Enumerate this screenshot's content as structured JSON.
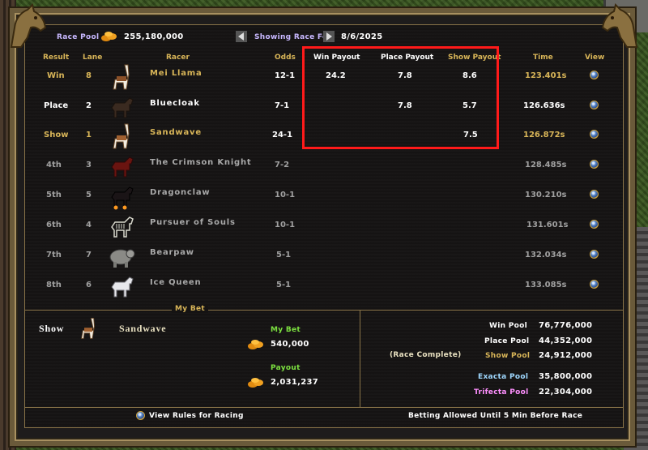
{
  "header": {
    "race_pool_label": "Race Pool",
    "race_pool_value": "255,180,000",
    "showing_label": "Showing Race For",
    "race_date": "8/6/2025"
  },
  "columns": {
    "result": "Result",
    "lane": "Lane",
    "racer": "Racer",
    "odds": "Odds",
    "win_payout": "Win Payout",
    "place_payout": "Place Payout",
    "show_payout": "Show Payout",
    "time": "Time",
    "view": "View"
  },
  "rows": [
    {
      "result": "Win",
      "lane": "8",
      "racer": "Mei Llama",
      "odds": "12-1",
      "win": "24.2",
      "place": "7.8",
      "show": "8.6",
      "time": "123.401s",
      "icon": "llama-icon"
    },
    {
      "result": "Place",
      "lane": "2",
      "racer": "Bluecloak",
      "odds": "7-1",
      "win": "",
      "place": "7.8",
      "show": "5.7",
      "time": "126.636s",
      "icon": "dark-horse-icon"
    },
    {
      "result": "Show",
      "lane": "1",
      "racer": "Sandwave",
      "odds": "24-1",
      "win": "",
      "place": "",
      "show": "7.5",
      "time": "126.872s",
      "icon": "llama-icon"
    },
    {
      "result": "4th",
      "lane": "3",
      "racer": "The Crimson Knight",
      "odds": "7-2",
      "win": "",
      "place": "",
      "show": "",
      "time": "128.485s",
      "icon": "red-horse-icon"
    },
    {
      "result": "5th",
      "lane": "5",
      "racer": "Dragonclaw",
      "odds": "10-1",
      "win": "",
      "place": "",
      "show": "",
      "time": "130.210s",
      "icon": "nightmare-icon"
    },
    {
      "result": "6th",
      "lane": "4",
      "racer": "Pursuer of Souls",
      "odds": "10-1",
      "win": "",
      "place": "",
      "show": "",
      "time": "131.601s",
      "icon": "skeletal-horse-icon"
    },
    {
      "result": "7th",
      "lane": "7",
      "racer": "Bearpaw",
      "odds": "5-1",
      "win": "",
      "place": "",
      "show": "",
      "time": "132.034s",
      "icon": "bear-icon"
    },
    {
      "result": "8th",
      "lane": "6",
      "racer": "Ice Queen",
      "odds": "5-1",
      "win": "",
      "place": "",
      "show": "",
      "time": "133.085s",
      "icon": "white-horse-icon"
    }
  ],
  "my_bet": {
    "section_label": "My Bet",
    "bet_type": "Show",
    "racer": "Sandwave",
    "bet_label": "My Bet",
    "bet_amount": "540,000",
    "payout_label": "Payout",
    "payout_amount": "2,031,237"
  },
  "pools": {
    "status": "(Race Complete)",
    "win_label": "Win Pool",
    "win_value": "76,776,000",
    "place_label": "Place Pool",
    "place_value": "44,352,000",
    "show_label": "Show Pool",
    "show_value": "24,912,000",
    "exacta_label": "Exacta Pool",
    "exacta_value": "35,800,000",
    "trifecta_label": "Trifecta Pool",
    "trifecta_value": "22,304,000"
  },
  "footer": {
    "rules_label": "View Rules for Racing",
    "betting_note": "Betting Allowed Until 5 Min Before Race"
  },
  "colors": {
    "gold": "#d8b558",
    "highlight": "#ff1a1a",
    "bet_green": "#7ce040",
    "exacta": "#9fd8ff",
    "trifecta": "#ff90ff"
  }
}
